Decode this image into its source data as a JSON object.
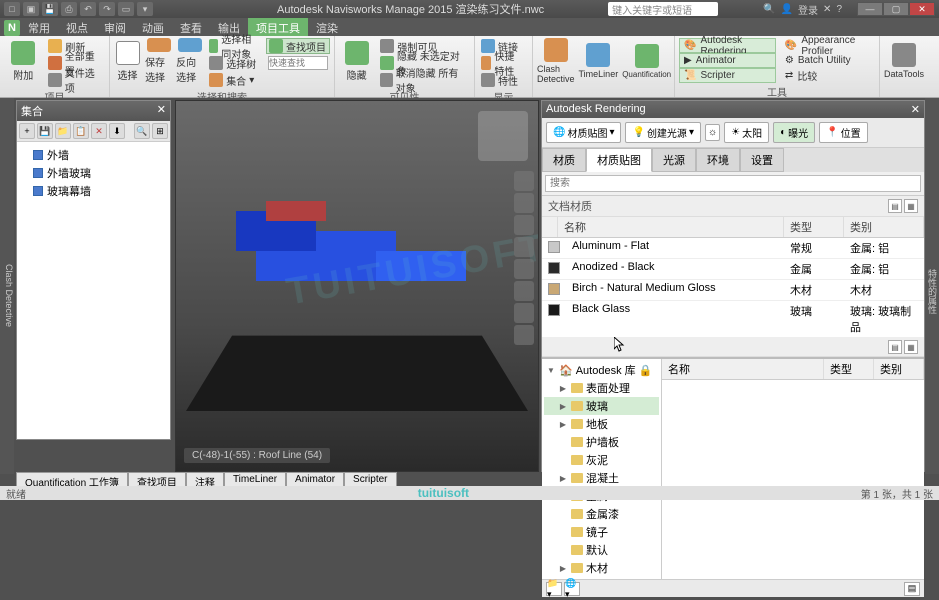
{
  "title": "Autodesk Navisworks Manage 2015   渲染练习文件.nwc",
  "search_placeholder": "键入关键字或短语",
  "user": {
    "login": "登录"
  },
  "menu_tabs": [
    "常用",
    "视点",
    "审阅",
    "动画",
    "查看",
    "输出",
    "项目工具",
    "渲染"
  ],
  "menu_active_index": 6,
  "ribbon": {
    "groups": [
      {
        "label": "项目",
        "big": {
          "text": "附加"
        },
        "items": [
          "刷新",
          "全部重置",
          "文件选项"
        ]
      },
      {
        "label": "选择和搜索",
        "big": [
          {
            "text": "选择"
          },
          {
            "text": "保存选择"
          },
          {
            "text": "反向选择"
          }
        ],
        "items": [
          "选择相同对象",
          "选择树",
          "集合"
        ],
        "pressed": "查找项目"
      },
      {
        "label": "可见性",
        "big": {
          "text": "隐藏"
        },
        "items": [
          "强制可见",
          "隐藏 未选定对象",
          "取消隐藏 所有对象"
        ]
      },
      {
        "label": "显示",
        "items": [
          "链接",
          "快捷 特性",
          "特性"
        ]
      },
      {
        "label": "",
        "big": [
          {
            "text": "Clash Detective"
          },
          {
            "text": "TimeLiner"
          },
          {
            "text": "Quantification"
          }
        ]
      },
      {
        "label": "工具",
        "items": [
          {
            "text": "Autodesk Rendering",
            "active": true
          },
          {
            "text": "Animator",
            "active": true
          },
          {
            "text": "Scripter",
            "active": true
          },
          {
            "text": "Appearance Profiler"
          },
          {
            "text": "Batch Utility"
          },
          {
            "text": "比较"
          }
        ]
      },
      {
        "label": "",
        "big": {
          "text": "DataTools"
        }
      }
    ]
  },
  "sets_panel": {
    "title": "集合",
    "items": [
      "外墙",
      "外墙玻璃",
      "玻璃幕墙"
    ]
  },
  "viewport_status": "C(-48)-1(-55) : Roof Line (54)",
  "render_panel": {
    "title": "Autodesk Rendering",
    "topbar": {
      "mat_map": "材质贴图",
      "create_light": "创建光源",
      "sun": "太阳",
      "exposure": "曝光",
      "location": "位置"
    },
    "tabs": [
      "材质",
      "材质贴图",
      "光源",
      "环境",
      "设置"
    ],
    "tabs_active": 1,
    "search_placeholder": "搜索",
    "doc_materials": {
      "label": "文档材质",
      "cols": [
        "名称",
        "类型",
        "类别"
      ],
      "rows": [
        {
          "name": "Aluminum - Flat",
          "type": "常规",
          "cat": "金属: 铝",
          "sw": "#c8c8c8"
        },
        {
          "name": "Anodized - Black",
          "type": "金属",
          "cat": "金属: 铝",
          "sw": "#2a2a2a"
        },
        {
          "name": "Birch - Natural Medium Gloss",
          "type": "木材",
          "cat": "木材",
          "sw": "#c9a875"
        },
        {
          "name": "Black Glass",
          "type": "玻璃",
          "cat": "玻璃: 玻璃制品",
          "sw": "#1a1a1a"
        }
      ]
    },
    "library": {
      "root": "Autodesk 库",
      "nodes": [
        "表面处理",
        "玻璃",
        "地板",
        "护墙板",
        "灰泥",
        "混凝土",
        "金属",
        "金属漆",
        "镜子",
        "默认",
        "木材"
      ],
      "selected_index": 1,
      "cols": [
        "名称",
        "类型",
        "类别"
      ]
    }
  },
  "bottom_tabs": [
    "Quantification 工作簿",
    "查找项目",
    "注释",
    "TimeLiner",
    "Animator",
    "Scripter"
  ],
  "statusbar": {
    "left": "就绪",
    "sheets": "第 1 张，共 1 张"
  },
  "sidebar_left_label": "Clash Detective",
  "sidebar_right_label": "特性的属性",
  "watermark": "tuituisoft"
}
